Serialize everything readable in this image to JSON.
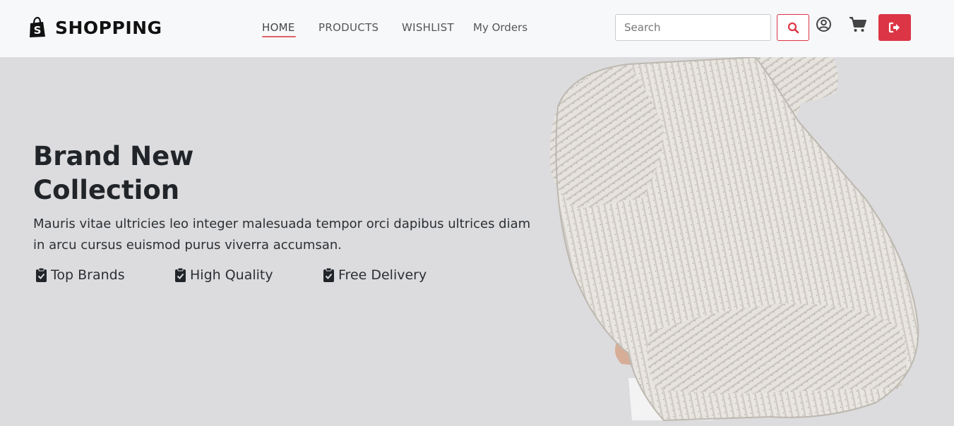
{
  "brand": {
    "name": "SHOPPING",
    "icon": "shopify-bag-icon"
  },
  "nav": {
    "items": [
      {
        "label": "HOME",
        "active": true
      },
      {
        "label": "PRODUCTS",
        "active": false
      },
      {
        "label": "WISHLIST",
        "active": false
      },
      {
        "label": "My Orders",
        "active": false
      }
    ]
  },
  "search": {
    "placeholder": "Search",
    "value": ""
  },
  "actions": {
    "search_icon": "search-icon",
    "user_icon": "user-circle-icon",
    "cart_icon": "cart-icon",
    "logout_icon": "sign-out-icon"
  },
  "hero": {
    "title": "Brand New Collection",
    "description": "Mauris vitae ultricies leo integer malesuada tempor orci dapibus ultrices diam in arcu cursus euismod purus viverra accumsan.",
    "features": [
      {
        "label": "Top Brands",
        "icon": "clipboard-check-icon"
      },
      {
        "label": "High Quality",
        "icon": "clipboard-check-icon"
      },
      {
        "label": "Free Delivery",
        "icon": "clipboard-check-icon"
      }
    ],
    "image": "person-in-knit-sweater-photo"
  },
  "colors": {
    "accent": "#dc3545",
    "nav_background": "#f7f8fa",
    "hero_background": "#dcdcde",
    "text": "#212529"
  }
}
